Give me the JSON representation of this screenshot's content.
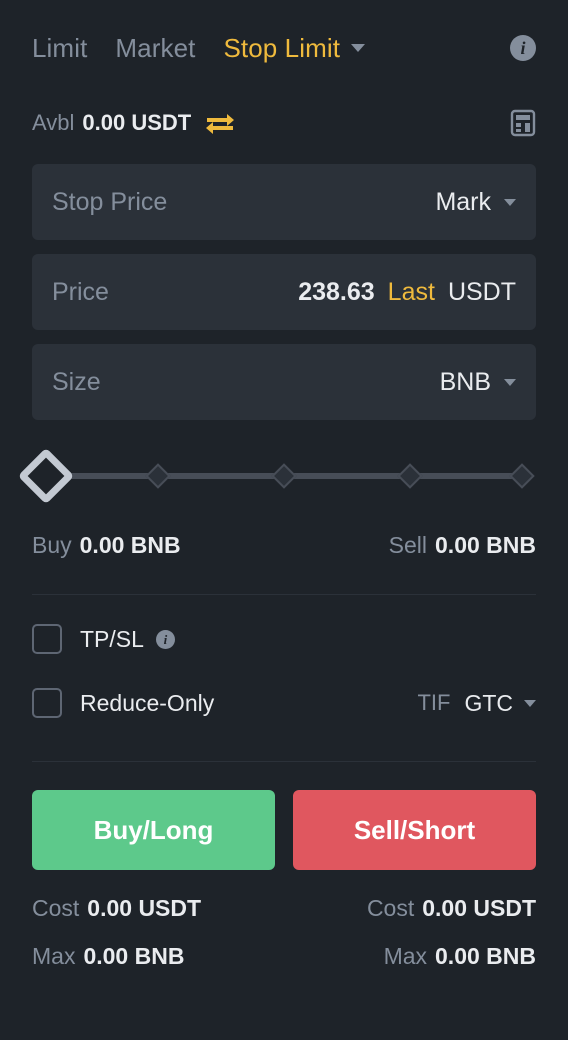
{
  "tabs": [
    {
      "label": "Limit",
      "active": false
    },
    {
      "label": "Market",
      "active": false
    },
    {
      "label": "Stop Limit",
      "active": true
    }
  ],
  "header": {
    "info_icon": "info-icon",
    "info_glyph": "i"
  },
  "balance": {
    "label": "Avbl",
    "value": "0.00 USDT",
    "transfer_icon": "transfer-arrows-icon",
    "calculator_icon": "calculator-icon"
  },
  "fields": {
    "stop_price": {
      "placeholder": "Stop Price",
      "value": "",
      "trigger_type": "Mark"
    },
    "price": {
      "placeholder": "Price",
      "value": "238.63",
      "source": "Last",
      "unit": "USDT"
    },
    "size": {
      "placeholder": "Size",
      "value": "",
      "unit": "BNB"
    }
  },
  "slider": {
    "value": 0,
    "ticks": [
      0,
      25,
      50,
      75,
      100
    ]
  },
  "quantities": {
    "buy_label": "Buy",
    "buy_value": "0.00 BNB",
    "sell_label": "Sell",
    "sell_value": "0.00 BNB"
  },
  "options": {
    "tpsl_label": "TP/SL",
    "tpsl_checked": false,
    "tpsl_info_glyph": "i",
    "reduce_only_label": "Reduce-Only",
    "reduce_only_checked": false,
    "tif_label": "TIF",
    "tif_value": "GTC"
  },
  "actions": {
    "buy_label": "Buy/Long",
    "sell_label": "Sell/Short"
  },
  "footer": {
    "buy_cost_label": "Cost",
    "buy_cost_value": "0.00 USDT",
    "buy_max_label": "Max",
    "buy_max_value": "0.00 BNB",
    "sell_cost_label": "Cost",
    "sell_cost_value": "0.00 USDT",
    "sell_max_label": "Max",
    "sell_max_value": "0.00 BNB"
  },
  "colors": {
    "background": "#1E2329",
    "field_bg": "#2B3139",
    "accent": "#EFBA3D",
    "text_primary": "#EAECEF",
    "text_muted": "#848E9C",
    "buy_green": "#5DC98B",
    "sell_red": "#E0575F"
  }
}
